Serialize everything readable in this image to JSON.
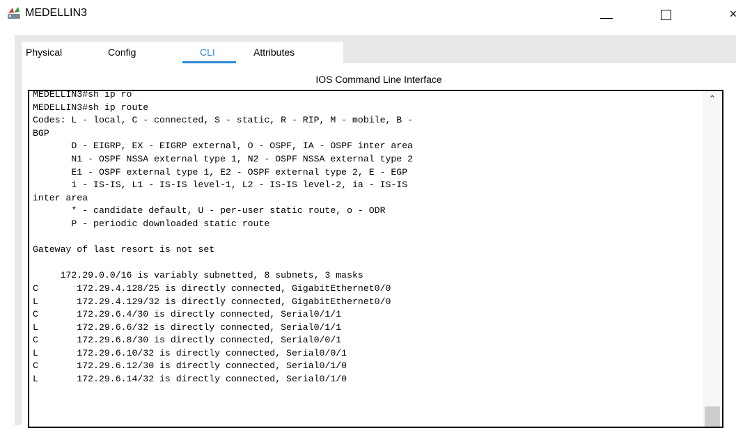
{
  "window": {
    "title": "MEDELLIN3",
    "minimize_glyph": "",
    "maximize_glyph": "",
    "close_glyph": "×",
    "icon": "router-icon"
  },
  "tabs": [
    {
      "label": "Physical"
    },
    {
      "label": "Config"
    },
    {
      "label": "CLI",
      "active": true
    },
    {
      "label": "Attributes"
    }
  ],
  "cli": {
    "heading": "IOS Command Line Interface",
    "output": "MEDELLIN3#sh ip ro\nMEDELLIN3#sh ip route\nCodes: L - local, C - connected, S - static, R - RIP, M - mobile, B -\nBGP\n       D - EIGRP, EX - EIGRP external, O - OSPF, IA - OSPF inter area\n       N1 - OSPF NSSA external type 1, N2 - OSPF NSSA external type 2\n       E1 - OSPF external type 1, E2 - OSPF external type 2, E - EGP\n       i - IS-IS, L1 - IS-IS level-1, L2 - IS-IS level-2, ia - IS-IS\ninter area\n       * - candidate default, U - per-user static route, o - ODR\n       P - periodic downloaded static route\n\nGateway of last resort is not set\n\n     172.29.0.0/16 is variably subnetted, 8 subnets, 3 masks\nC       172.29.4.128/25 is directly connected, GigabitEthernet0/0\nL       172.29.4.129/32 is directly connected, GigabitEthernet0/0\nC       172.29.6.4/30 is directly connected, Serial0/1/1\nL       172.29.6.6/32 is directly connected, Serial0/1/1\nC       172.29.6.8/30 is directly connected, Serial0/0/1\nL       172.29.6.10/32 is directly connected, Serial0/0/1\nC       172.29.6.12/30 is directly connected, Serial0/1/0\nL       172.29.6.14/32 is directly connected, Serial0/1/0"
  },
  "scrollbar": {
    "up_glyph": "⌃"
  },
  "colors": {
    "accent": "#2f8ad6",
    "frame_bg": "#e8e8e8"
  }
}
